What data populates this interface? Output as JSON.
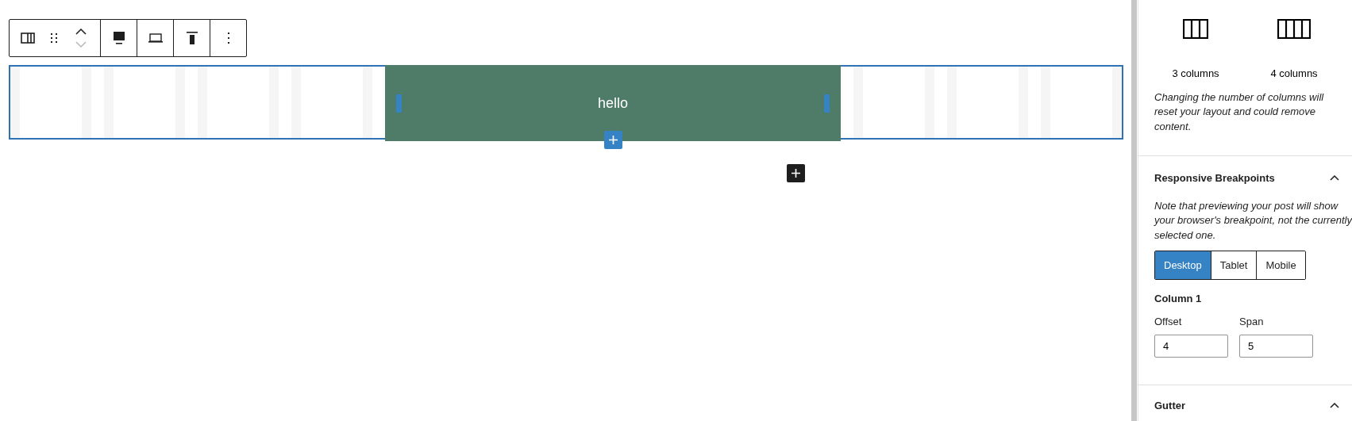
{
  "toolbar": {
    "move_up": {
      "disabled": false
    },
    "move_down": {
      "disabled": true
    }
  },
  "selected_column": {
    "text": "hello"
  },
  "sidebar": {
    "column_presets": [
      {
        "label": "3 columns"
      },
      {
        "label": "4 columns"
      }
    ],
    "warning": "Changing the number of columns will reset your layout and could remove content.",
    "panels": [
      {
        "title": "Responsive Breakpoints",
        "expanded": true,
        "note": "Note that previewing your post will show your browser's breakpoint, not the currently selected one.",
        "breakpoints": [
          {
            "label": "Desktop",
            "selected": true
          },
          {
            "label": "Tablet",
            "selected": false
          },
          {
            "label": "Mobile",
            "selected": false
          }
        ],
        "column_title": "Column 1",
        "fields": [
          {
            "label": "Offset",
            "value": "4"
          },
          {
            "label": "Span",
            "value": "5"
          }
        ]
      },
      {
        "title": "Gutter",
        "expanded": true
      }
    ]
  }
}
